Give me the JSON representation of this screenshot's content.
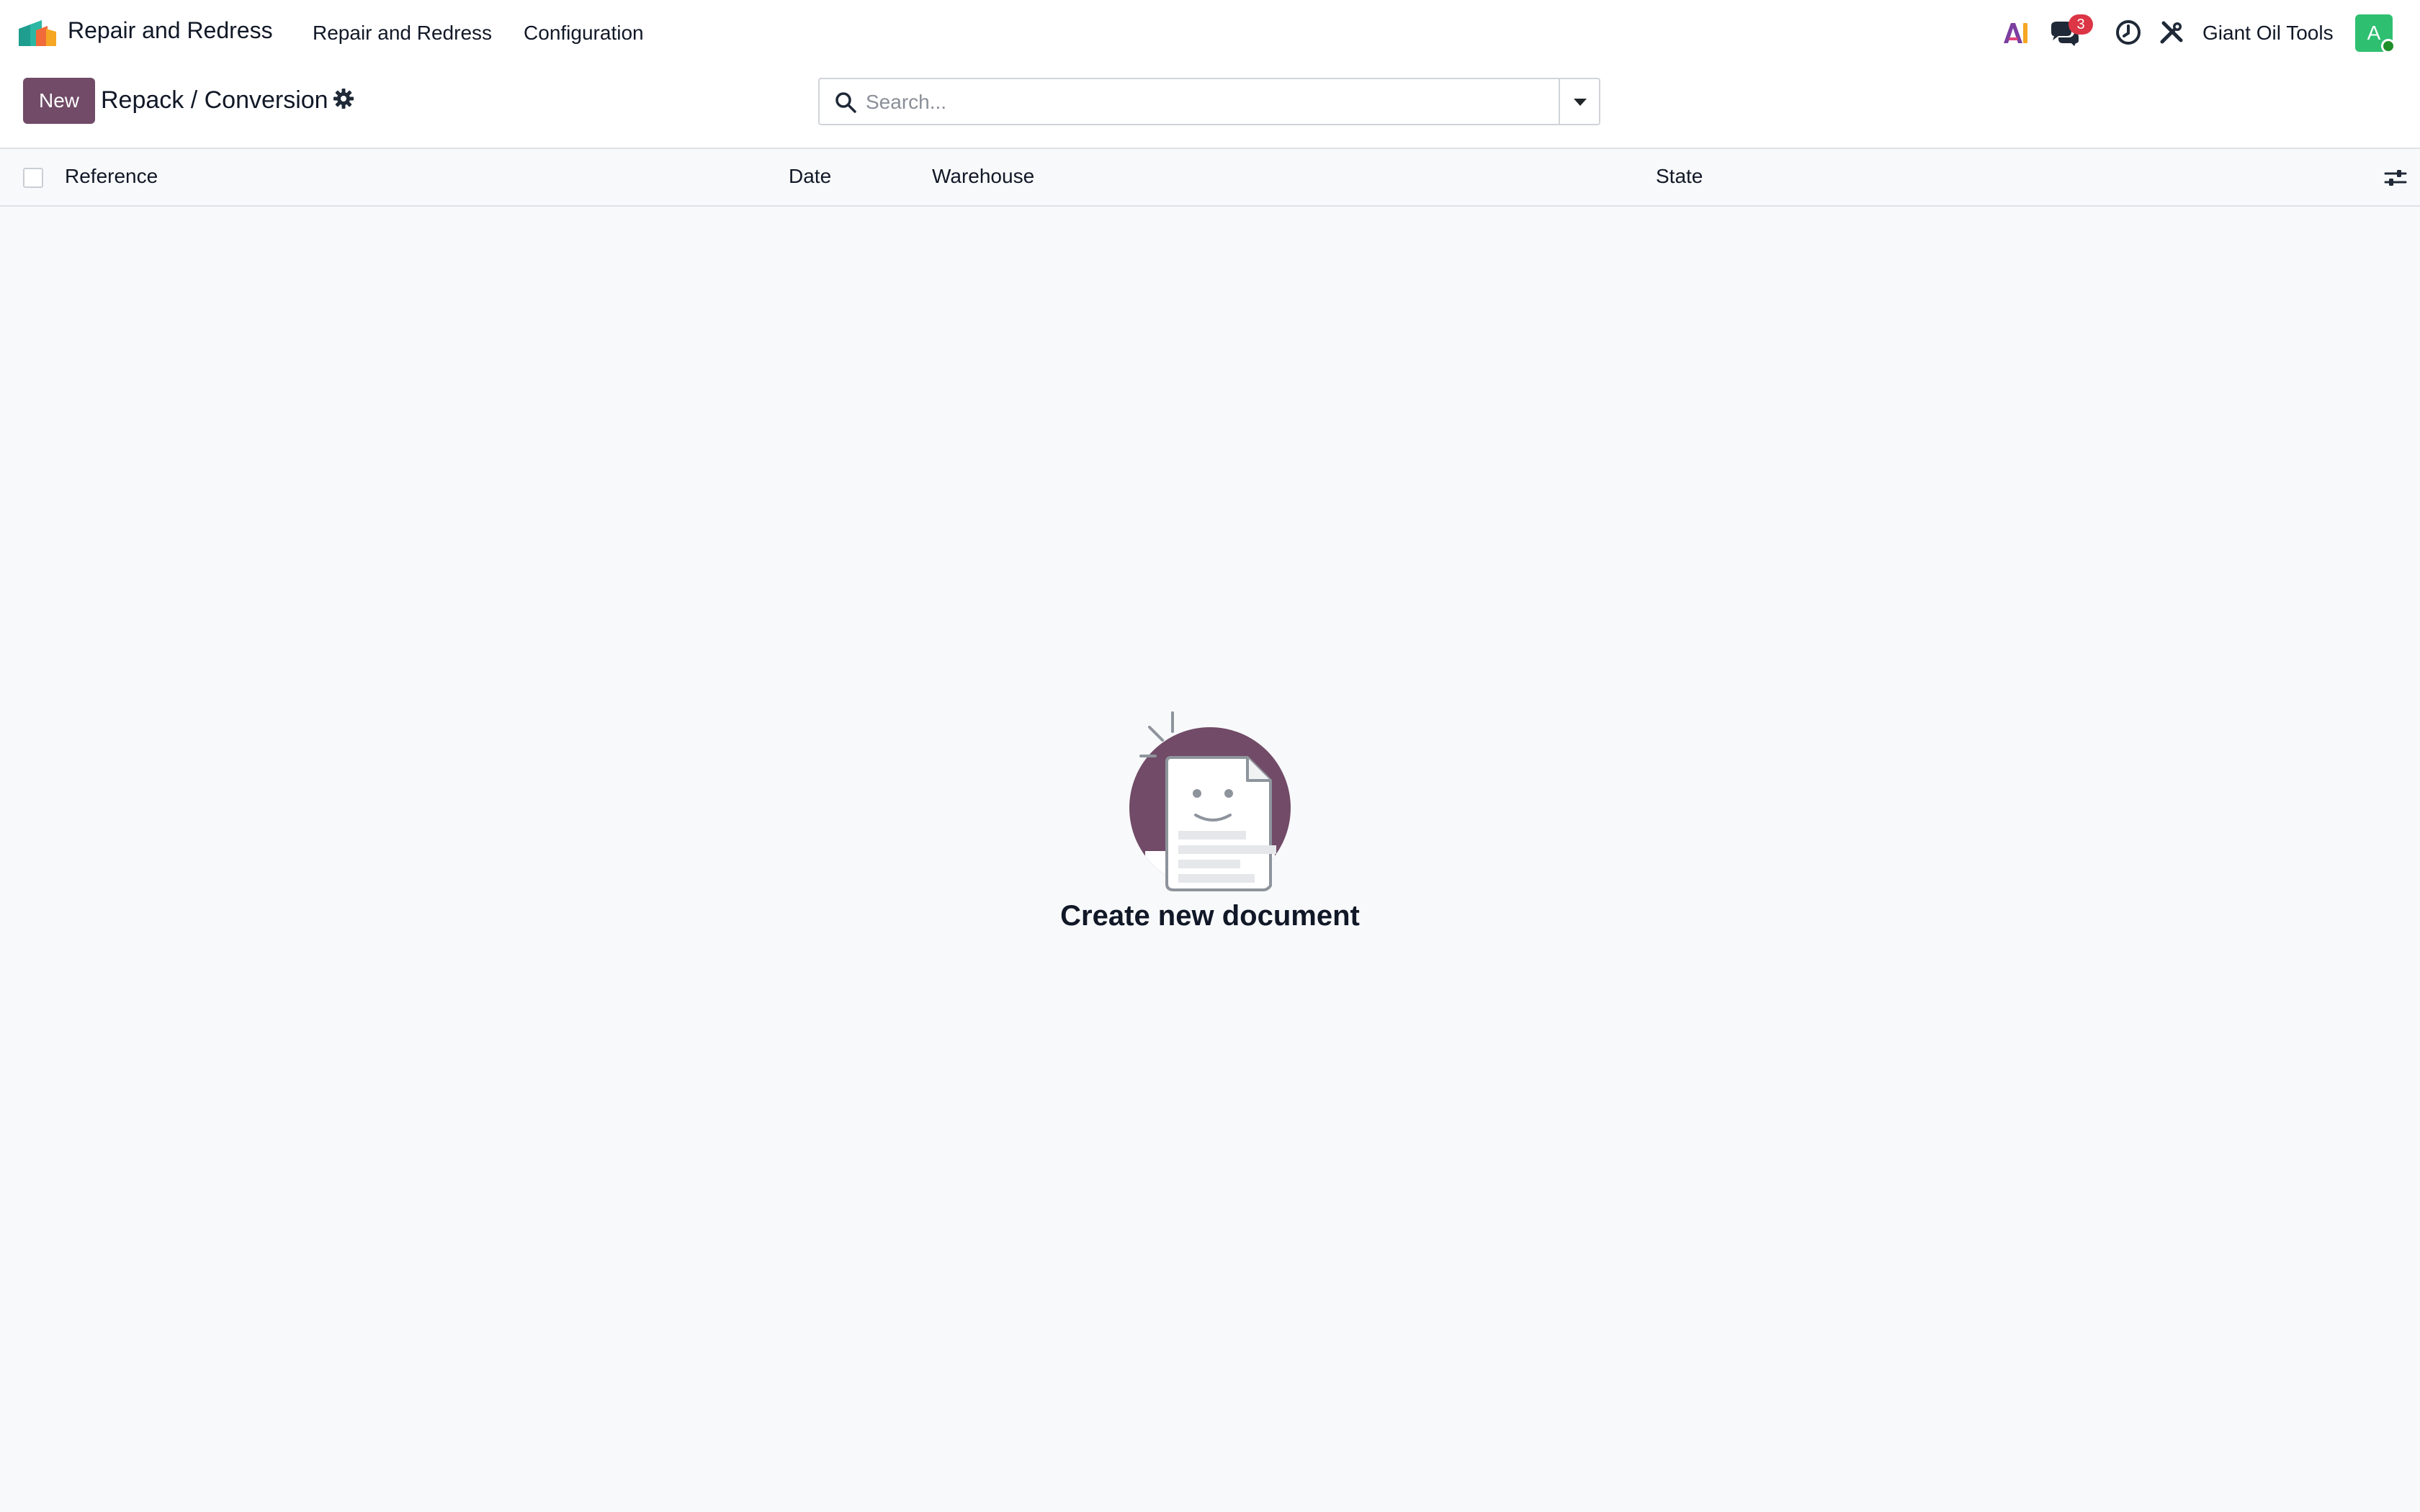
{
  "navbar": {
    "app_name": "Repair and Redress",
    "menu": [
      {
        "label": "Repair and Redress"
      },
      {
        "label": "Configuration"
      }
    ],
    "systray": {
      "ai_icon": "ai-icon",
      "messages_icon": "chat-icon",
      "messages_count": "3",
      "activity_icon": "clock-icon",
      "debug_icon": "tools-icon",
      "company": "Giant Oil Tools",
      "avatar_initial": "A"
    }
  },
  "control_panel": {
    "new_label": "New",
    "breadcrumb": "Repack / Conversion",
    "search": {
      "placeholder": "Search...",
      "value": ""
    }
  },
  "list": {
    "columns": [
      "Reference",
      "Date",
      "Warehouse",
      "State"
    ],
    "rows": []
  },
  "empty_state": {
    "title": "Create new document"
  },
  "colors": {
    "brand": "#714b67",
    "badge": "#dc3545",
    "avatar": "#2fbf71"
  }
}
